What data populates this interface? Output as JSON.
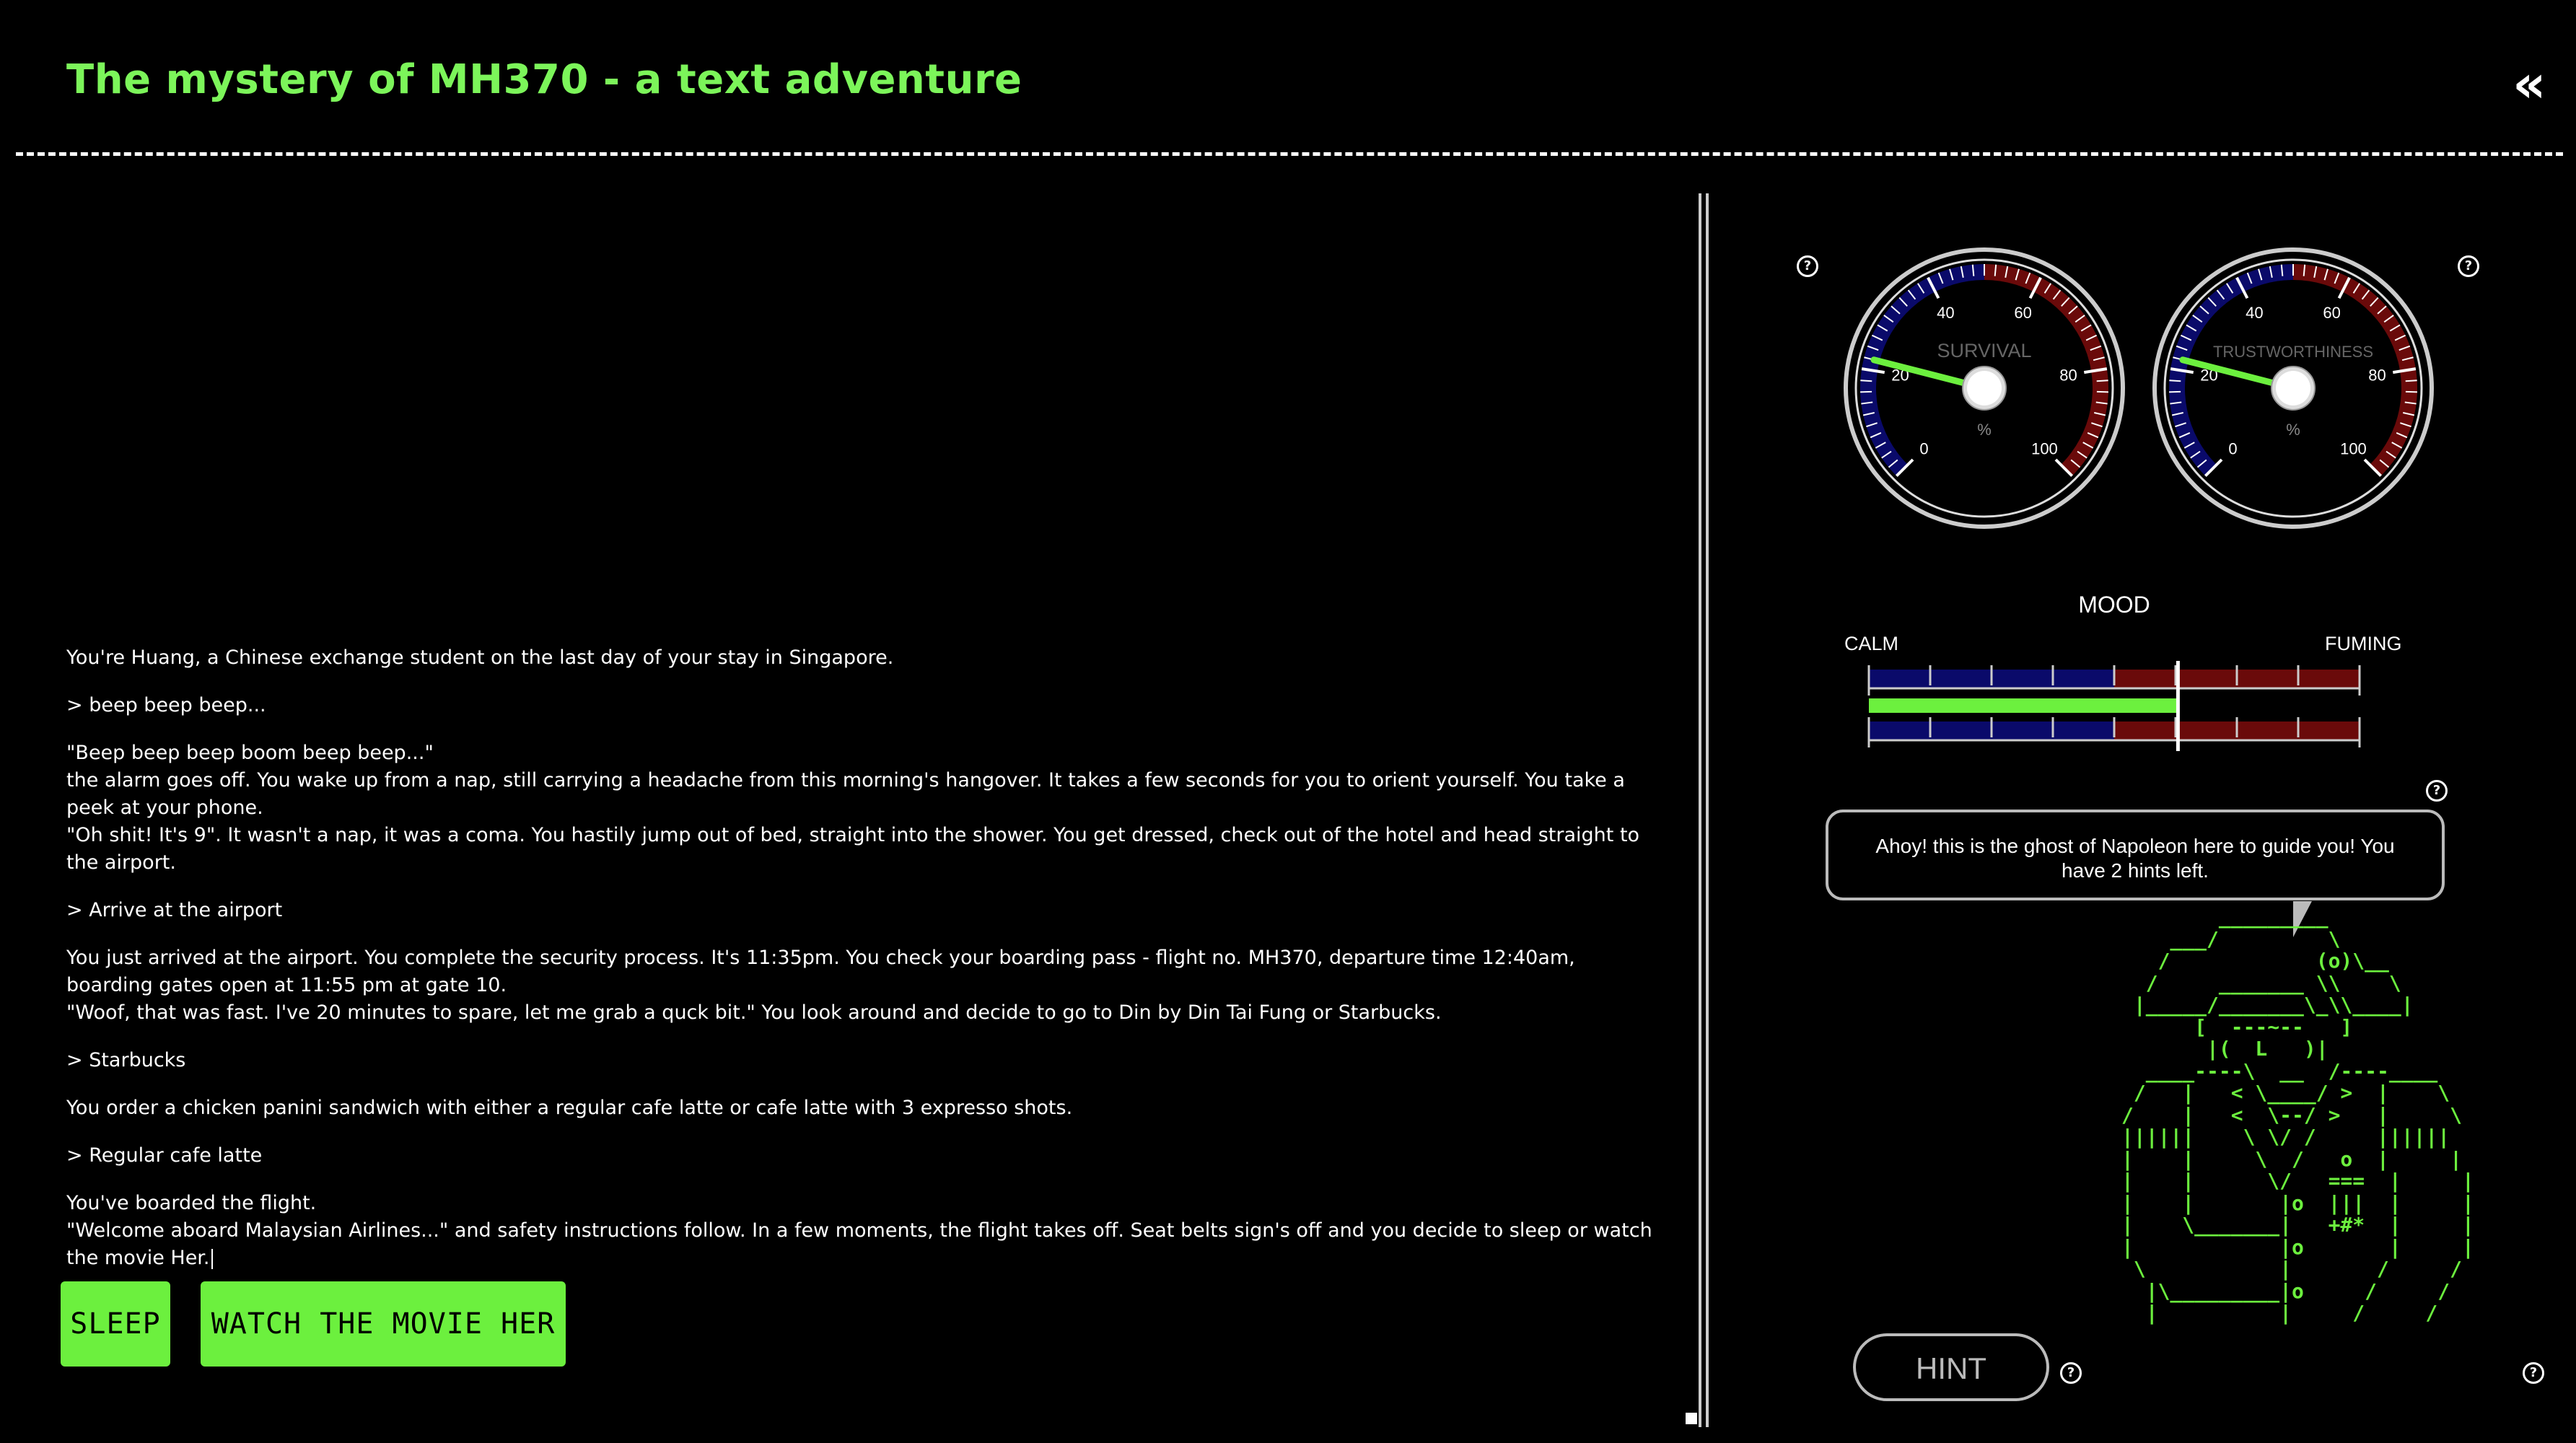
{
  "header": {
    "title": "The mystery of MH370 - a text adventure",
    "collapse_icon": "«"
  },
  "story": {
    "paragraphs": [
      "You're Huang, a Chinese exchange student on the last day of your stay in Singapore.",
      "> beep beep beep...",
      "\"Beep beep beep boom beep beep...\"\nthe alarm goes off. You wake up from a nap, still carrying a headache from this morning's hangover. It takes a few seconds for you to orient yourself. You take a peek at your phone.\n\"Oh shit! It's 9\". It wasn't a nap, it was a coma. You hastily jump out of bed, straight into the shower. You get dressed, check out of the hotel and head straight to the airport.",
      "> Arrive at the airport",
      "You just arrived at the airport. You complete the security process. It's 11:35pm. You check your boarding pass - flight no. MH370, departure time 12:40am, boarding gates open at 11:55 pm at gate 10.\n\"Woof, that was fast. I've 20 minutes to spare, let me grab a quck bit.\" You look around and decide to go to Din by Din Tai Fung or Starbucks.",
      "> Starbucks",
      "You order a chicken panini sandwich with either a regular cafe latte or cafe latte with 3 expresso shots.",
      "> Regular cafe latte",
      "You've boarded the flight.\n\"Welcome aboard Malaysian Airlines...\" and safety instructions follow. In a few moments, the flight takes off. Seat belts sign's off and you decide to sleep or watch the movie Her."
    ]
  },
  "choices": {
    "sleep": "SLEEP",
    "watch": "WATCH THE MOVIE HER"
  },
  "gauges": [
    {
      "label": "SURVIVAL",
      "unit": "%",
      "value": 22,
      "ticks": [
        "0",
        "20",
        "40",
        "60",
        "80",
        "100"
      ]
    },
    {
      "label": "TRUSTWORTHINESS",
      "unit": "%",
      "value": 22,
      "ticks": [
        "0",
        "20",
        "40",
        "60",
        "80",
        "100"
      ]
    }
  ],
  "mood": {
    "title": "MOOD",
    "low_label": "CALM",
    "high_label": "FUMING",
    "value": 0.63
  },
  "help_icon": "?",
  "napoleon": {
    "message": "Ahoy! this is the ghost of Napoleon here to guide you! You have 2 hints left.",
    "ascii": "        _________\n    ___/         \\\n   /            (o)\\__\n  /     _______ \\\\    \\\n |_____/_______\\_\\\\____|\n      [  ---~--   ]\n       |(  L   )|\n  ____----\\  __  /----____\n /   |   < \\____/ >  |    \\\n/    |   <  \\--/ >   |     \\\n||||||    \\ \\/ /     ||||||\n|    |     \\  /   o  |     |\n|    |      \\/   ===  |     |\n|    |       |o  |||  |     |\n|    \\_______|   +#*  |     |\n|            |o       |     |\n \\           |       /     /\n  |\\_________|o     /     /\n  |          |     /     /",
    "hint_label": "HINT"
  },
  "colors": {
    "accent": "#6cf03e",
    "gauge_low": "#0a0a6a",
    "gauge_high": "#6a0a0a",
    "needle": "#6cf03e"
  }
}
